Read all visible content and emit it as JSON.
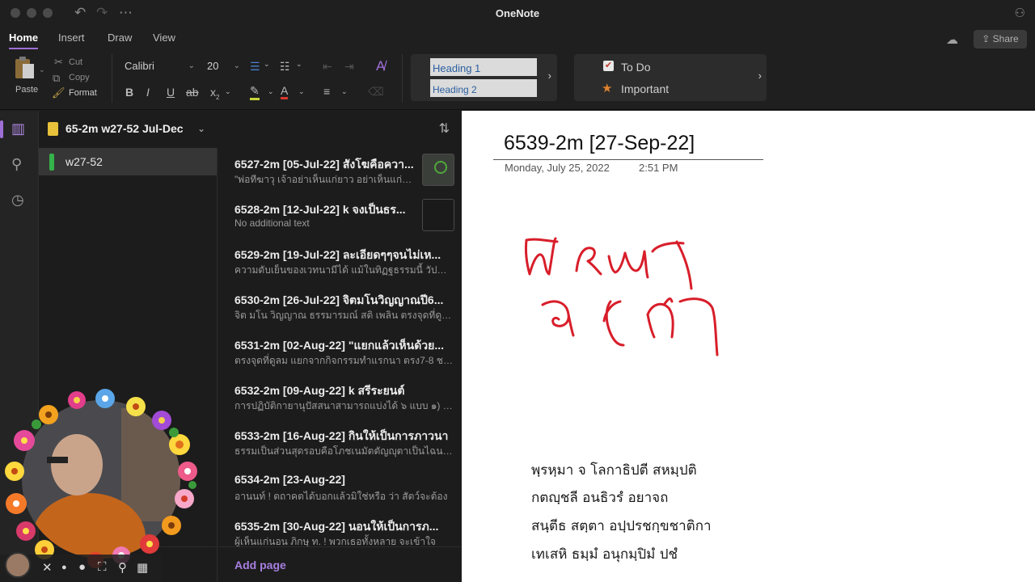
{
  "window": {
    "title": "OneNote"
  },
  "ribbon": {
    "tabs": [
      {
        "label": "Home"
      },
      {
        "label": "Insert"
      },
      {
        "label": "Draw"
      },
      {
        "label": "View"
      }
    ],
    "active_tab": "Home",
    "share_label": "Share"
  },
  "toolbar": {
    "paste_label": "Paste",
    "cut_label": "Cut",
    "copy_label": "Copy",
    "format_label": "Format",
    "font_family": "Calibri",
    "font_size": "20",
    "styles": [
      "Heading 1",
      "Heading 2"
    ],
    "tags": [
      {
        "label": "To Do",
        "icon": "checkbox-icon"
      },
      {
        "label": "Important",
        "icon": "star-icon"
      }
    ]
  },
  "colors": {
    "accent": "#9e6fd6",
    "section_green": "#35b24a",
    "notebook_yellow": "#e7c23a",
    "ink_red": "#d81e2a"
  },
  "notebook": {
    "title": "65-2m w27-52 Jul-Dec"
  },
  "sections": [
    {
      "label": "w27-52"
    }
  ],
  "pages": [
    {
      "title": "6527-2m [05-Jul-22] สังโฆคือควา...",
      "subtitle": "\"พ่อทีฆาวุ เจ้าอย่าเห็นแก่ยาว อย่าเห็นแก่สั้น...",
      "thumb": "image"
    },
    {
      "title": "6528-2m [12-Jul-22] k จงเป็นธร...",
      "subtitle": "No additional text",
      "thumb": "blank"
    },
    {
      "title": "6529-2m [19-Jul-22] ละเอียดๆๆจนไม่เห...",
      "subtitle": "ความดับเย็นของเวทนามีได้ แม้ในทิฏฐธรรมนี้ วัปปะ !"
    },
    {
      "title": "6530-2m [26-Jul-22] จิตมโนวิญญาณปี6...",
      "subtitle": "จิต มโน วิญญาณ ธรรมารมณ์ สติ เพลิน ตรงจุดที่ดูลม"
    },
    {
      "title": "6531-2m [02-Aug-22]  \"แยกแล้วเห็นด้วย...",
      "subtitle": "ตรงจุดที่ดูลม แยกจากกิจกรรมทำแรกนา ตรง7-8 ชว..."
    },
    {
      "title": "6532-2m [09-Aug-22] k สรีระยนต์",
      "subtitle": "การปฏิบัติกายานุปัสสนาสามารถแบ่งได้ ๖ แบบ ๑) อ..."
    },
    {
      "title": "6533-2m [16-Aug-22] กินให้เป็นการภาวนา",
      "subtitle": "ธรรมเป็นส่วนสุดรอบคือโภชเนมัตตัญญุตาเป็นไฉน?..."
    },
    {
      "title": "6534-2m [23-Aug-22]",
      "subtitle": "อานนท์ ! ตถาคตได้บอกแล้วมิใช่หรือ ว่า  สัตว์จะต้อง"
    },
    {
      "title": "6535-2m [30-Aug-22] นอนให้เป็นการภ...",
      "subtitle": "ผู้เห็นแก่นอน  ภิกษุ ท. ! พวกเธอทั้งหลาย จะเข้าใจ"
    }
  ],
  "add_page_label": "Add page",
  "note": {
    "title": "6539-2m [27-Sep-22]",
    "date": "Monday, July 25, 2022",
    "time": "2:51 PM",
    "handwriting": [
      "พรหมา",
      "จ โวิกา"
    ],
    "lines": [
      "พฺรหฺมา จ โลกาธิปตี สหมฺปติ",
      "กตญฺชลี อนธิวรํ อยาจถ",
      "สนฺตีธ สตฺตา อปฺปรชกฺขชาติกา",
      "เทเสหิ ธมฺมํ อนุกมฺปิมํ ปชํ"
    ]
  }
}
